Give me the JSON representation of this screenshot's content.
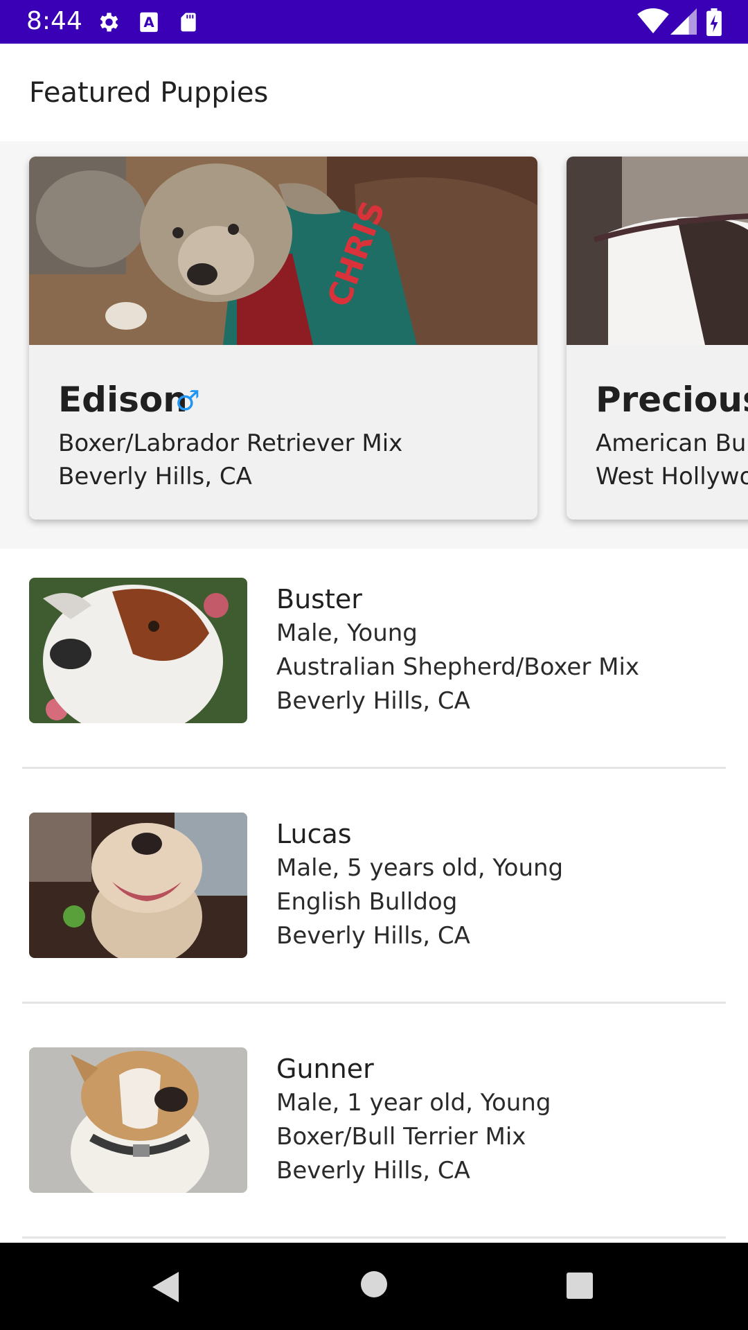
{
  "status_bar": {
    "time": "8:44",
    "left_icons": [
      "gear-icon",
      "font-a-icon",
      "sd-card-icon"
    ],
    "right_icons": [
      "wifi-icon",
      "signal-icon",
      "battery-icon"
    ],
    "background": "#3a00b5"
  },
  "app_bar": {
    "title": "Featured Puppies"
  },
  "featured": [
    {
      "name": "Edison",
      "gender_symbol": "♂",
      "breed": "Boxer/Labrador Retriever Mix",
      "location": "Beverly Hills, CA"
    },
    {
      "name": "Precious",
      "gender_symbol": "",
      "breed": "American Bu",
      "location": "West Hollywo"
    }
  ],
  "list": [
    {
      "name": "Buster",
      "line1": "Male, Young",
      "line2": "Australian Shepherd/Boxer Mix",
      "line3": "Beverly Hills, CA"
    },
    {
      "name": "Lucas",
      "line1": "Male, 5 years old, Young",
      "line2": "English Bulldog",
      "line3": "Beverly Hills, CA"
    },
    {
      "name": "Gunner",
      "line1": "Male, 1 year old, Young",
      "line2": "Boxer/Bull Terrier Mix",
      "line3": "Beverly Hills, CA"
    }
  ],
  "nav_bar": {
    "buttons": [
      "back-icon",
      "home-icon",
      "recents-icon"
    ]
  },
  "colors": {
    "accent_gender": "#2196f3",
    "status_bar": "#3a00b5"
  }
}
